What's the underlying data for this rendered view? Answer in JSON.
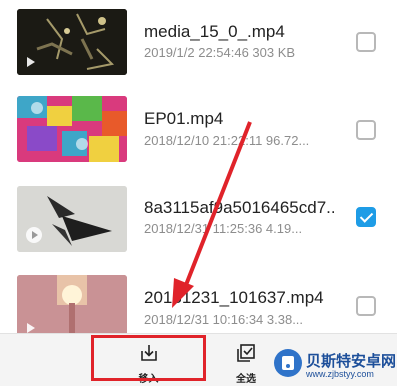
{
  "files": [
    {
      "name": "media_15_0_.mp4",
      "meta": "2019/1/2 22:54:46 303 KB",
      "checked": false
    },
    {
      "name": "EP01.mp4",
      "meta": "2018/12/10 21:22:11 96.72...",
      "checked": false
    },
    {
      "name": "8a3115af9a5016465cd7...",
      "meta": "2018/12/31 11:25:36 4.19...",
      "checked": true
    },
    {
      "name": "20181231_101637.mp4",
      "meta": "2018/12/31 10:16:34 3.38...",
      "checked": false
    }
  ],
  "toolbar": {
    "move_in_label": "移入",
    "select_all_label": "全选"
  },
  "watermark": {
    "text": "贝斯特安卓网",
    "url": "www.zjbstyy.com"
  },
  "colors": {
    "accent": "#1e9ce6",
    "annotation_red": "#e0232a"
  },
  "icons": [
    "play-icon",
    "checkbox-icon",
    "download-icon",
    "select-all-icon"
  ]
}
